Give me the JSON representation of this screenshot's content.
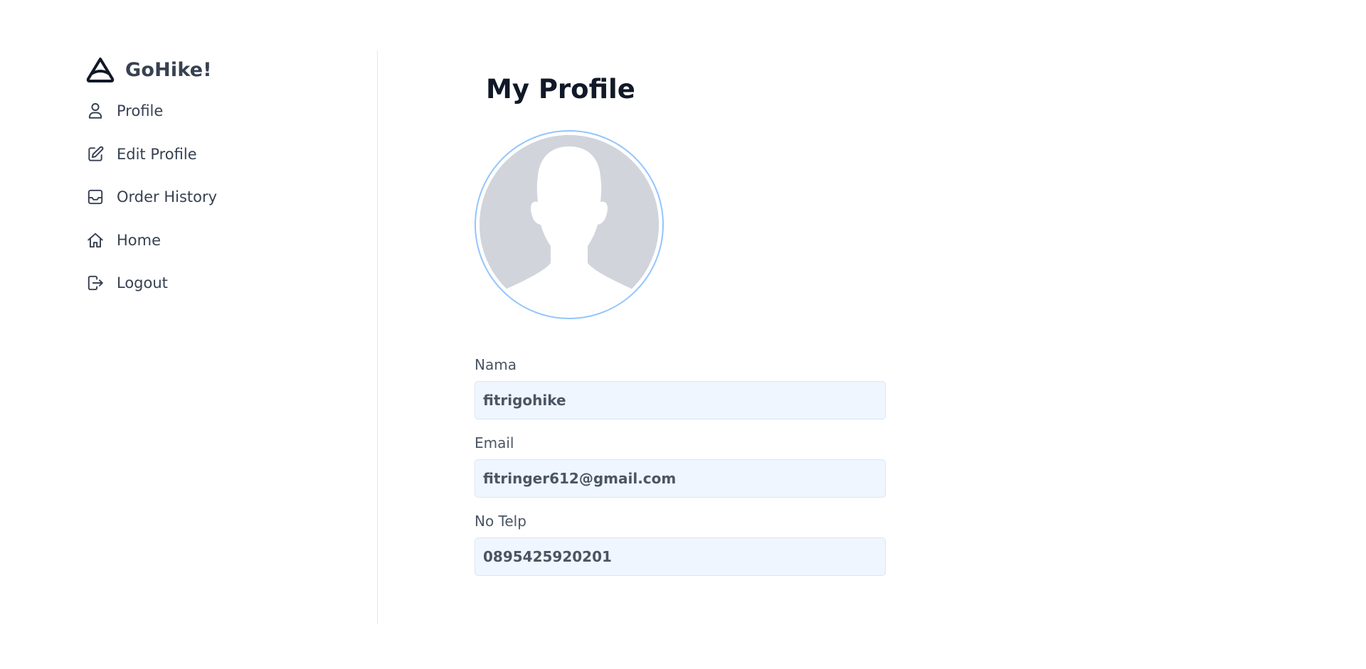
{
  "brand": {
    "name": "GoHike!",
    "logo_icon": "triangle-logo-icon"
  },
  "sidebar": {
    "items": [
      {
        "label": "Profile",
        "icon": "user-icon"
      },
      {
        "label": "Edit Profile",
        "icon": "edit-icon"
      },
      {
        "label": "Order History",
        "icon": "inbox-icon"
      },
      {
        "label": "Home",
        "icon": "home-icon"
      },
      {
        "label": "Logout",
        "icon": "logout-icon"
      }
    ]
  },
  "main": {
    "title": "My Profile",
    "avatar": {
      "icon": "default-avatar-icon"
    },
    "fields": [
      {
        "label": "Nama",
        "value": "fitrigohike"
      },
      {
        "label": "Email",
        "value": "fitringer612@gmail.com"
      },
      {
        "label": "No Telp",
        "value": "0895425920201"
      }
    ]
  },
  "colors": {
    "text": "#374151",
    "title": "#111827",
    "input_bg": "#eff6ff",
    "avatar_ring": "#93c5fd",
    "avatar_fill": "#d1d5db",
    "divider": "#e5e7eb"
  }
}
